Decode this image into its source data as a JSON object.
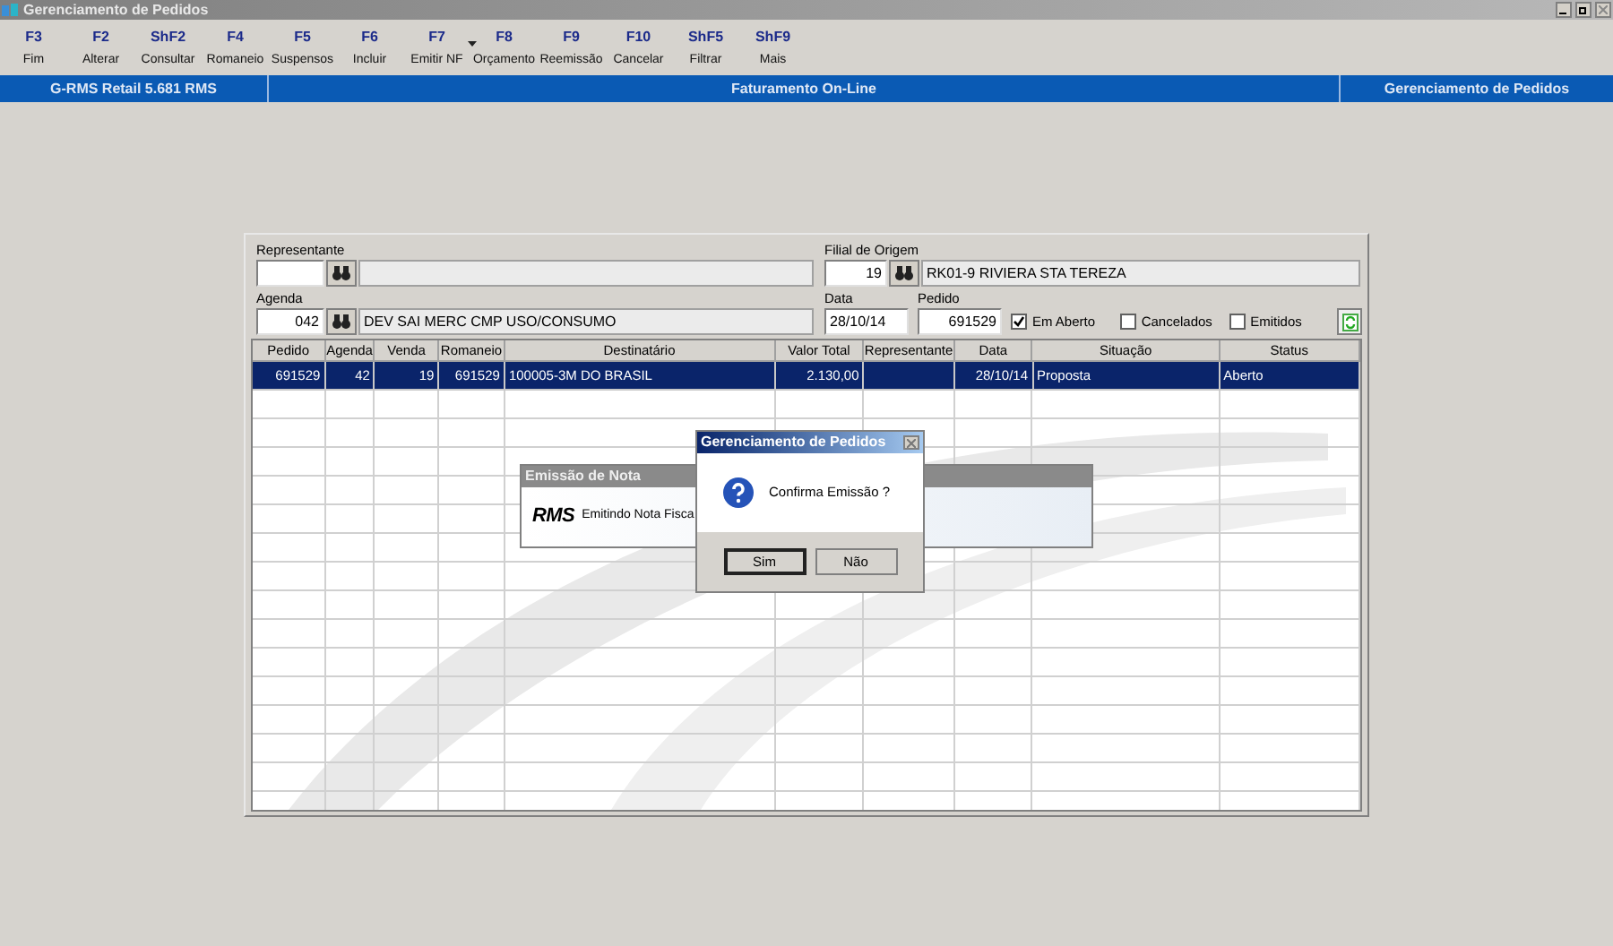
{
  "window": {
    "title": "Gerenciamento de Pedidos"
  },
  "toolbar": {
    "items": [
      {
        "key": "F3",
        "label": "Fim",
        "has_menu": false
      },
      {
        "key": "F2",
        "label": "Alterar",
        "has_menu": false
      },
      {
        "key": "ShF2",
        "label": "Consultar",
        "has_menu": false
      },
      {
        "key": "F4",
        "label": "Romaneio",
        "has_menu": false
      },
      {
        "key": "F5",
        "label": "Suspensos",
        "has_menu": false
      },
      {
        "key": "F6",
        "label": "Incluir",
        "has_menu": false
      },
      {
        "key": "F7",
        "label": "Emitir NF",
        "has_menu": true
      },
      {
        "key": "F8",
        "label": "Orçamento",
        "has_menu": false
      },
      {
        "key": "F9",
        "label": "Reemissão",
        "has_menu": false
      },
      {
        "key": "F10",
        "label": "Cancelar",
        "has_menu": false
      },
      {
        "key": "ShF5",
        "label": "Filtrar",
        "has_menu": false
      },
      {
        "key": "ShF9",
        "label": "Mais",
        "has_menu": false
      }
    ]
  },
  "banner": [
    "G-RMS Retail 5.681 RMS",
    "Faturamento On-Line",
    "Gerenciamento de Pedidos"
  ],
  "filters": {
    "representante": {
      "label": "Representante"
    },
    "filial": {
      "label": "Filial de Origem",
      "code": "19",
      "name": "RK01-9 RIVIERA STA TEREZA"
    },
    "agenda": {
      "label": "Agenda",
      "code": "042",
      "name": "DEV SAI MERC CMP USO/CONSUMO"
    },
    "data": {
      "label": "Data",
      "value": "28/10/14"
    },
    "pedido": {
      "label": "Pedido",
      "value": "691529"
    },
    "checkboxes": [
      {
        "label": "Em Aberto",
        "checked": true
      },
      {
        "label": "Cancelados",
        "checked": false
      },
      {
        "label": "Emitidos",
        "checked": false
      }
    ]
  },
  "table": {
    "columns": [
      "Pedido",
      "Agenda",
      "Venda",
      "Romaneio",
      "Destinatário",
      "Valor Total",
      "Representante",
      "Data",
      "Situação",
      "Status"
    ],
    "rows": [
      {
        "selected": true,
        "cells": [
          "691529",
          "42",
          "19",
          "691529",
          "100005-3M DO BRASIL",
          "2.130,00",
          null,
          "28/10/14",
          "Proposta",
          "Aberto"
        ]
      }
    ]
  },
  "progress_dialog": {
    "title": "Emissão de Nota",
    "logo_text": "RMS",
    "message": "Emitindo Nota Fisca"
  },
  "confirm_dialog": {
    "title": "Gerenciamento de Pedidos",
    "message": "Confirma Emissão ?",
    "buttons": [
      {
        "label": "Sim",
        "selected": true
      },
      {
        "label": "Não",
        "selected": false
      }
    ]
  }
}
